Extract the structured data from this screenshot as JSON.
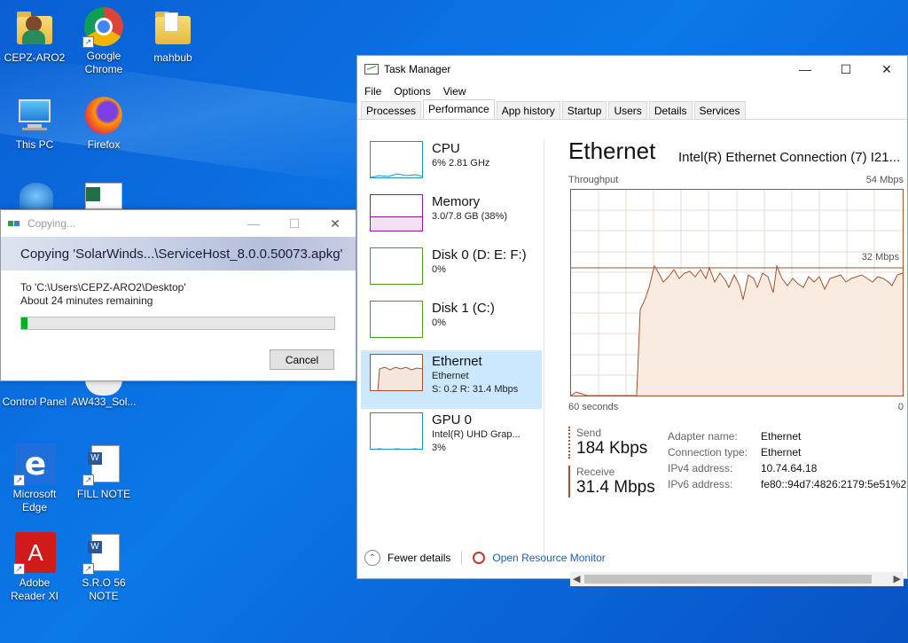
{
  "desktop": {
    "icons": [
      {
        "label": "CEPZ-ARO2",
        "icon": "user-folder-icon"
      },
      {
        "label": "Google Chrome",
        "icon": "chrome-icon"
      },
      {
        "label": "mahbub",
        "icon": "folder-icon"
      },
      {
        "label": "This PC",
        "icon": "computer-icon"
      },
      {
        "label": "Firefox",
        "icon": "firefox-icon"
      },
      {
        "label": "Control Panel",
        "icon": "control-panel-icon"
      },
      {
        "label": "AW433_Sol...",
        "icon": "document-icon"
      },
      {
        "label": "Microsoft Edge",
        "icon": "edge-icon"
      },
      {
        "label": "FILL NOTE",
        "icon": "word-doc-icon"
      },
      {
        "label": "Adobe Reader XI",
        "icon": "adobe-reader-icon"
      },
      {
        "label": "S.R.O 56 NOTE",
        "icon": "word-doc-icon"
      }
    ]
  },
  "copy_dialog": {
    "title": "Copying...",
    "banner": "Copying 'SolarWinds...\\ServiceHost_8.0.0.50073.apkg'",
    "to": "To 'C:\\Users\\CEPZ-ARO2\\Desktop'",
    "remaining": "About 24 minutes remaining",
    "progress_fraction": 0.02,
    "cancel_label": "Cancel",
    "accent_color": "#06b025"
  },
  "task_manager": {
    "title": "Task Manager",
    "menu": [
      "File",
      "Options",
      "View"
    ],
    "tabs": [
      "Processes",
      "Performance",
      "App history",
      "Startup",
      "Users",
      "Details",
      "Services"
    ],
    "active_tab": "Performance",
    "sidebar": [
      {
        "label": "CPU",
        "sub1": "6% 2.81 GHz",
        "sub2": "",
        "color": "#1e90c8"
      },
      {
        "label": "Memory",
        "sub1": "3.0/7.8 GB (38%)",
        "sub2": "",
        "color": "#8b1a8b"
      },
      {
        "label": "Disk 0 (D: E: F:)",
        "sub1": "0%",
        "sub2": "",
        "color": "#4a9a1a"
      },
      {
        "label": "Disk 1 (C:)",
        "sub1": "0%",
        "sub2": "",
        "color": "#4a9a1a"
      },
      {
        "label": "Ethernet",
        "sub1": "Ethernet",
        "sub2": "S: 0.2 R: 31.4 Mbps",
        "color": "#a0522d"
      },
      {
        "label": "GPU 0",
        "sub1": "Intel(R) UHD Grap...",
        "sub2": "3%",
        "color": "#1e90c8"
      }
    ],
    "detail": {
      "title": "Ethernet",
      "adapter": "Intel(R) Ethernet Connection (7) I21...",
      "graph_label": "Throughput",
      "graph_max": "54 Mbps",
      "graph_mid": "32 Mbps",
      "time_left": "60 seconds",
      "time_right": "0",
      "send_label": "Send",
      "send_value": "184 Kbps",
      "receive_label": "Receive",
      "receive_value": "31.4 Mbps",
      "properties": [
        {
          "key": "Adapter name:",
          "value": "Ethernet"
        },
        {
          "key": "Connection type:",
          "value": "Ethernet"
        },
        {
          "key": "IPv4 address:",
          "value": "10.74.64.18"
        },
        {
          "key": "IPv6 address:",
          "value": "fe80::94d7:4826:2179:5e51%2"
        }
      ]
    },
    "footer": {
      "fewer_details": "Fewer details",
      "resource_monitor": "Open Resource Monitor"
    }
  }
}
